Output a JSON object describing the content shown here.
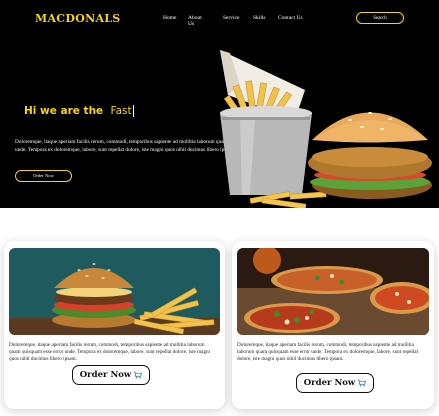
{
  "header": {
    "logo": "MACDONALS",
    "nav": [
      "Home",
      "About Us",
      "Service",
      "Skills",
      "Contact Us"
    ],
    "search_label": "Search"
  },
  "hero": {
    "title_prefix": "Hi we are the",
    "title_highlight": "Fast",
    "description": "Doloremque, itaque aperiam facilis rerum, commodi, temporibus sapiente ad mollitia laborum quam quisquam esse error unde. Tempora ex doloremque, labore, sunt repellat dolore, iste magni quos nihil ducimus libero ipsam.",
    "order_label": "Order Now"
  },
  "cards": [
    {
      "image": "burger-fries-photo",
      "text": "Doloremque, itaque aperiam facilis rerum, commodi, temporibus sapiente ad mollitia laborum quam quisquam esse error unde. Tempora ex doloremque, labore, sunt repellat dolore, iste magni quos nihil ducimus libero ipsam.",
      "order_label": "Order Now"
    },
    {
      "image": "pizza-table-photo",
      "text": "Doloremque, itaque aperiam facilis rerum, commodi, temporibus sapiente ad mollitia laborum quam quisquam esse error unde. Tempora ex doloremque, labore, sunt repellat dolore, iste magni quos nihil ducimus libero ipsam.",
      "order_label": "Order Now"
    }
  ],
  "colors": {
    "accent": "#f5d315",
    "hero_bg": "#000000",
    "card_bg": "#ffffff"
  }
}
